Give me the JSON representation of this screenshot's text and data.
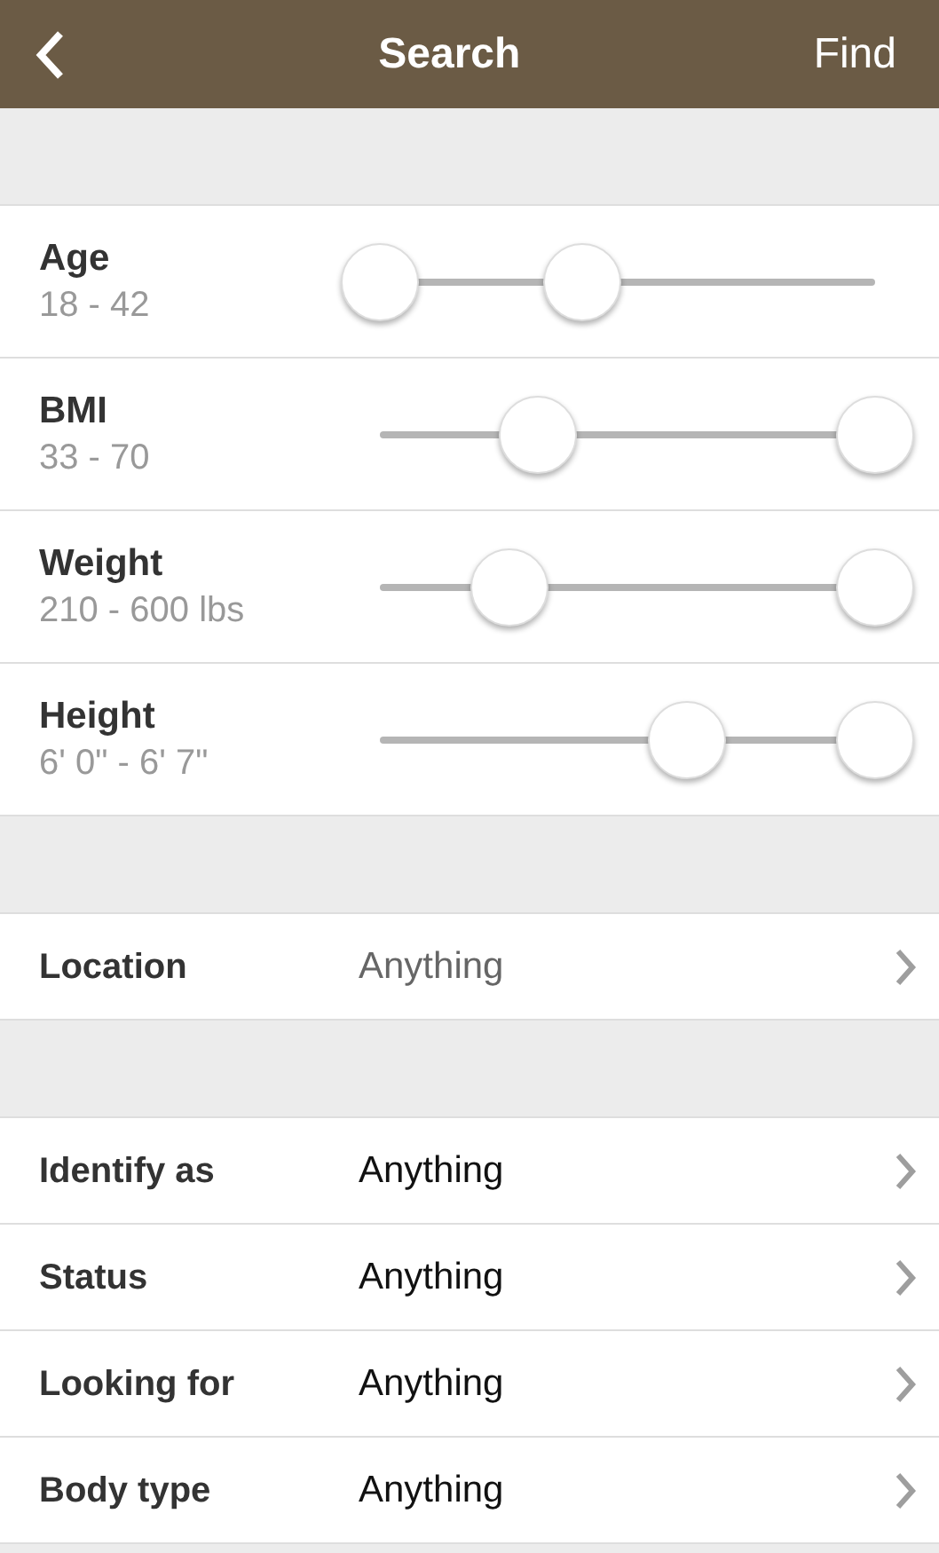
{
  "header": {
    "title": "Search",
    "action": "Find"
  },
  "ranges": [
    {
      "label": "Age",
      "reading": "18 - 42",
      "thumbs": [
        {
          "level": 0
        },
        {
          "level": 0.41
        }
      ]
    },
    {
      "label": "BMI",
      "reading": "33 - 70",
      "thumbs": [
        {
          "level": 0.32
        },
        {
          "level": 1
        }
      ]
    },
    {
      "label": "Weight",
      "reading": "210 - 600 lbs",
      "thumbs": [
        {
          "level": 0.26
        },
        {
          "level": 1
        }
      ]
    },
    {
      "label": "Height",
      "reading": "6' 0\" - 6' 7\"",
      "thumbs": [
        {
          "level": 0.62
        },
        {
          "level": 1
        }
      ]
    }
  ],
  "location": {
    "label": "Location",
    "value": "Anything"
  },
  "filters": [
    {
      "label": "Identify as",
      "value": "Anything"
    },
    {
      "label": "Status",
      "value": "Anything"
    },
    {
      "label": "Looking for",
      "value": "Anything"
    },
    {
      "label": "Body type",
      "value": "Anything"
    }
  ]
}
